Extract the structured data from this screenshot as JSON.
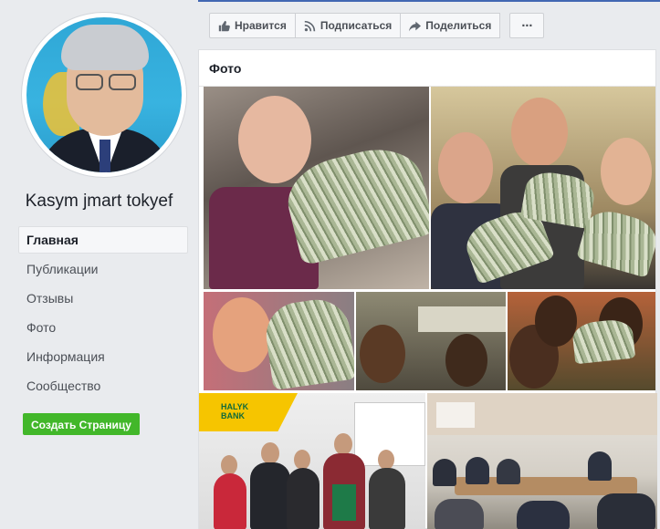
{
  "profile": {
    "name": "Kasym jmart tokyef"
  },
  "nav": {
    "items": [
      "Главная",
      "Публикации",
      "Отзывы",
      "Фото",
      "Информация",
      "Сообщество"
    ],
    "active": "Главная"
  },
  "create_page_button": "Создать Страницу",
  "actions": {
    "like": "Нравится",
    "follow": "Подписаться",
    "share": "Поделиться",
    "more": "⋯"
  },
  "photos": {
    "title": "Фото",
    "banner_text_1": "HALYK",
    "banner_text_2": "BANK"
  },
  "colors": {
    "accent": "#4267b2",
    "create_button": "#42b72a"
  }
}
